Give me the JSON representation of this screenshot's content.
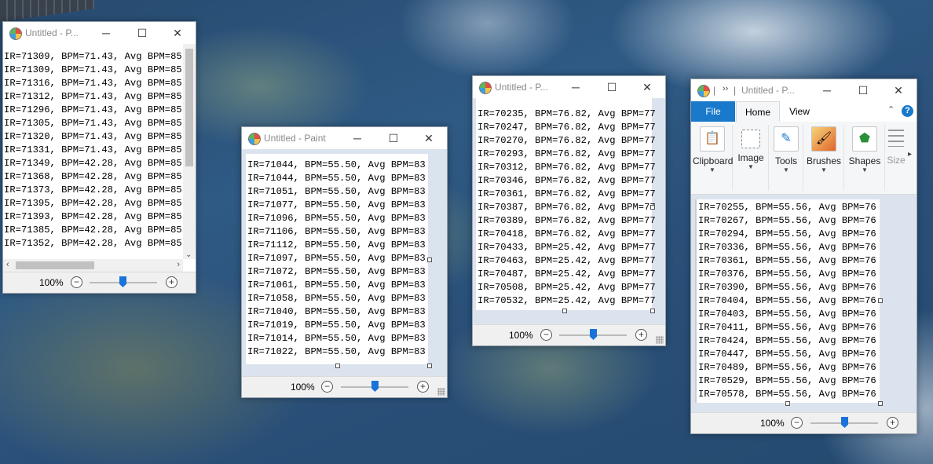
{
  "windows": [
    {
      "title": "Untitled - P...",
      "zoom": "100%",
      "lines": [
        "IR=71309, BPM=71.43, Avg BPM=85",
        "IR=71309, BPM=71.43, Avg BPM=85",
        "IR=71316, BPM=71.43, Avg BPM=85",
        "IR=71312, BPM=71.43, Avg BPM=85",
        "IR=71296, BPM=71.43, Avg BPM=85",
        "IR=71305, BPM=71.43, Avg BPM=85",
        "IR=71320, BPM=71.43, Avg BPM=85",
        "IR=71331, BPM=71.43, Avg BPM=85",
        "IR=71349, BPM=42.28, Avg BPM=85",
        "IR=71368, BPM=42.28, Avg BPM=85",
        "IR=71373, BPM=42.28, Avg BPM=85",
        "IR=71395, BPM=42.28, Avg BPM=85",
        "IR=71393, BPM=42.28, Avg BPM=85",
        "IR=71385, BPM=42.28, Avg BPM=85",
        "IR=71352, BPM=42.28, Avg BPM=85"
      ]
    },
    {
      "title": "Untitled - Paint",
      "zoom": "100%",
      "lines": [
        "IR=71044, BPM=55.50, Avg BPM=83",
        "IR=71044, BPM=55.50, Avg BPM=83",
        "IR=71051, BPM=55.50, Avg BPM=83",
        "IR=71077, BPM=55.50, Avg BPM=83",
        "IR=71096, BPM=55.50, Avg BPM=83",
        "IR=71106, BPM=55.50, Avg BPM=83",
        "IR=71112, BPM=55.50, Avg BPM=83",
        "IR=71097, BPM=55.50, Avg BPM=83",
        "IR=71072, BPM=55.50, Avg BPM=83",
        "IR=71061, BPM=55.50, Avg BPM=83",
        "IR=71058, BPM=55.50, Avg BPM=83",
        "IR=71040, BPM=55.50, Avg BPM=83",
        "IR=71019, BPM=55.50, Avg BPM=83",
        "IR=71014, BPM=55.50, Avg BPM=83",
        "IR=71022, BPM=55.50, Avg BPM=83"
      ]
    },
    {
      "title": "Untitled - P...",
      "zoom": "100%",
      "lines": [
        "IR=70235, BPM=76.82, Avg BPM=77",
        "IR=70247, BPM=76.82, Avg BPM=77",
        "IR=70270, BPM=76.82, Avg BPM=77",
        "IR=70293, BPM=76.82, Avg BPM=77",
        "IR=70312, BPM=76.82, Avg BPM=77",
        "IR=70346, BPM=76.82, Avg BPM=77",
        "IR=70361, BPM=76.82, Avg BPM=77",
        "IR=70387, BPM=76.82, Avg BPM=77",
        "IR=70389, BPM=76.82, Avg BPM=77",
        "IR=70418, BPM=76.82, Avg BPM=77",
        "IR=70433, BPM=25.42, Avg BPM=77",
        "IR=70463, BPM=25.42, Avg BPM=77",
        "IR=70487, BPM=25.42, Avg BPM=77",
        "IR=70508, BPM=25.42, Avg BPM=77",
        "IR=70532, BPM=25.42, Avg BPM=77"
      ]
    },
    {
      "title": "Untitled - P...",
      "zoom": "100%",
      "tabs": [
        "File",
        "Home",
        "View"
      ],
      "ribbon": [
        "Clipboard",
        "Image",
        "Tools",
        "Brushes",
        "Shapes",
        "Size"
      ],
      "lines": [
        "IR=70255, BPM=55.56, Avg BPM=76",
        "IR=70267, BPM=55.56, Avg BPM=76",
        "IR=70294, BPM=55.56, Avg BPM=76",
        "IR=70336, BPM=55.56, Avg BPM=76",
        "IR=70361, BPM=55.56, Avg BPM=76",
        "IR=70376, BPM=55.56, Avg BPM=76",
        "IR=70390, BPM=55.56, Avg BPM=76",
        "IR=70404, BPM=55.56, Avg BPM=76",
        "IR=70403, BPM=55.56, Avg BPM=76",
        "IR=70411, BPM=55.56, Avg BPM=76",
        "IR=70424, BPM=55.56, Avg BPM=76",
        "IR=70447, BPM=55.56, Avg BPM=76",
        "IR=70489, BPM=55.56, Avg BPM=76",
        "IR=70529, BPM=55.56, Avg BPM=76",
        "IR=70578, BPM=55.56, Avg BPM=76"
      ]
    }
  ],
  "colors": {
    "file_tab": "#1979ca",
    "slider": "#1a73d8"
  }
}
